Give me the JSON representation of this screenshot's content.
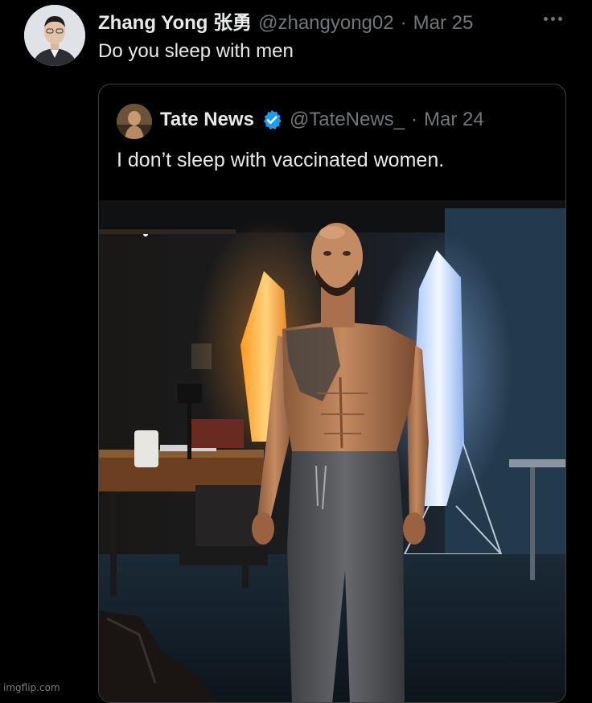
{
  "tweet": {
    "display_name": "Zhang Yong 张勇",
    "handle": "@zhangyong02",
    "separator": "·",
    "date": "Mar 25",
    "text": "Do you sleep with men",
    "more_icon": "ellipsis-icon"
  },
  "quoted_tweet": {
    "display_name": "Tate News",
    "verified": true,
    "verified_color": "#1d9bf0",
    "handle": "@TateNews_",
    "separator": "·",
    "date": "Mar 24",
    "text": "I don’t sleep with vaccinated women.",
    "media": "photo"
  },
  "watermark": "imgflip.com",
  "colors": {
    "background": "#000000",
    "primary_text": "#e7e9ea",
    "secondary_text": "#71767b",
    "border": "#3e4144"
  }
}
